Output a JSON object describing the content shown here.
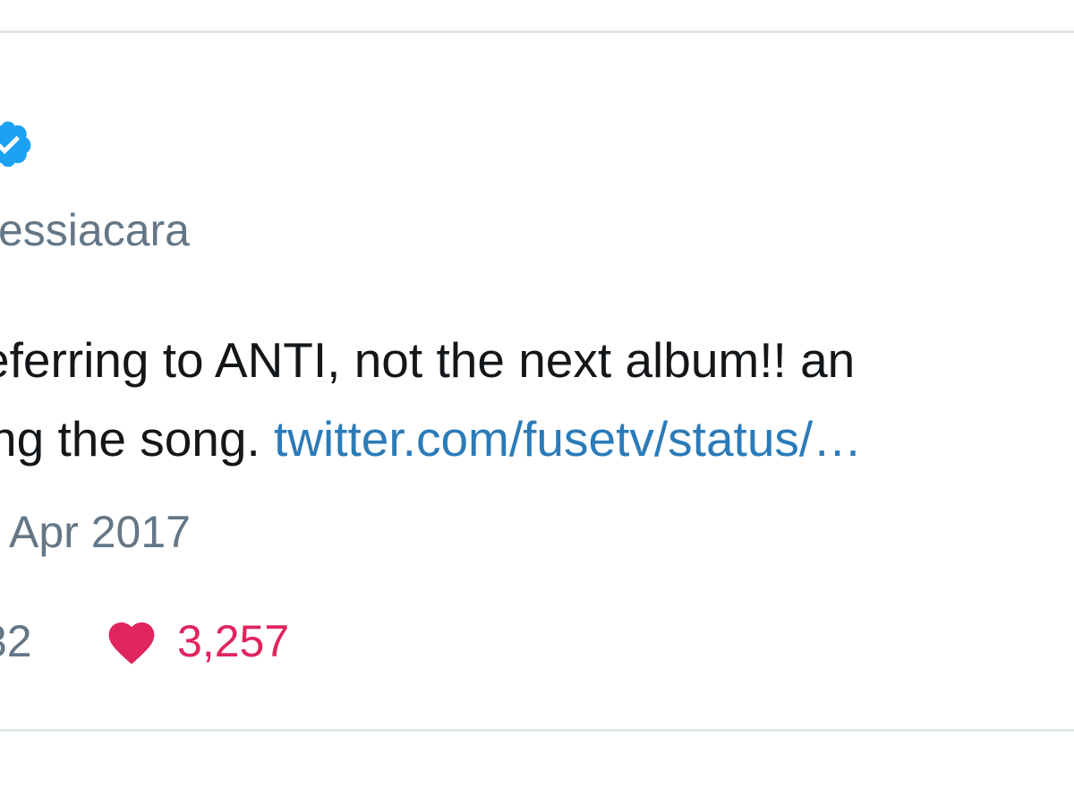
{
  "tweet": {
    "handle": "essiacara",
    "text_line1": "eferring to ANTI, not the next album!! an",
    "text_line2_prefix": "ng the song. ",
    "link_text": "twitter.com/fusetv/status/…",
    "timestamp": " Apr 2017",
    "retweet_count": "32",
    "like_count": "3,257"
  },
  "icons": {
    "verified": "verified-badge-icon",
    "like": "heart-icon"
  },
  "colors": {
    "verified_blue": "#1da1f2",
    "link_blue": "#2b7bb9",
    "like_red": "#e0245e",
    "meta_gray": "#657786",
    "text_dark": "#14171a",
    "divider": "#e1e8ed"
  }
}
